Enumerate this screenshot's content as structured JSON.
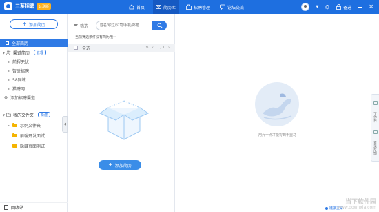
{
  "app": {
    "name": "三茅招聘",
    "badge": "公测版",
    "accent": "#1e6fe0"
  },
  "nav": {
    "items": [
      {
        "label": "首页",
        "icon": "home-icon"
      },
      {
        "label": "简历库",
        "icon": "mail-icon",
        "active": true
      },
      {
        "label": "招聘管理",
        "icon": "briefcase-icon"
      },
      {
        "label": "论坛交流",
        "icon": "chat-icon"
      }
    ],
    "right_label": "备选"
  },
  "sidebar": {
    "add_button": "添加简历",
    "all_resumes": "全部简历",
    "channel_group": {
      "label": "渠道简历",
      "tag": "管理"
    },
    "channels": [
      "前程无忧",
      "智联招聘",
      "58同城",
      "猎聘网"
    ],
    "add_channel": "添加招聘渠道",
    "folders_group": {
      "label": "我的文件夹",
      "tag": "新建"
    },
    "folders": [
      "示例文件夹",
      "前端开发面试",
      "隐藏页面测试"
    ],
    "recycle": "回收站"
  },
  "middle": {
    "filter_label": "筛选",
    "search_placeholder": "姓名/职位/公司/手机/邮箱",
    "hint": "当前筛选条件没有简历哦~",
    "list_header": {
      "select_all": "全选",
      "page": "1 / 1"
    },
    "add_button": "添加简历"
  },
  "right": {
    "empty_text": "用九一点才能得到千里马",
    "tools": [
      "工作台",
      "意见反馈"
    ],
    "status": "链接正常"
  },
  "watermark": {
    "line1": "当下软件园",
    "line2": "www.downxia.com"
  }
}
